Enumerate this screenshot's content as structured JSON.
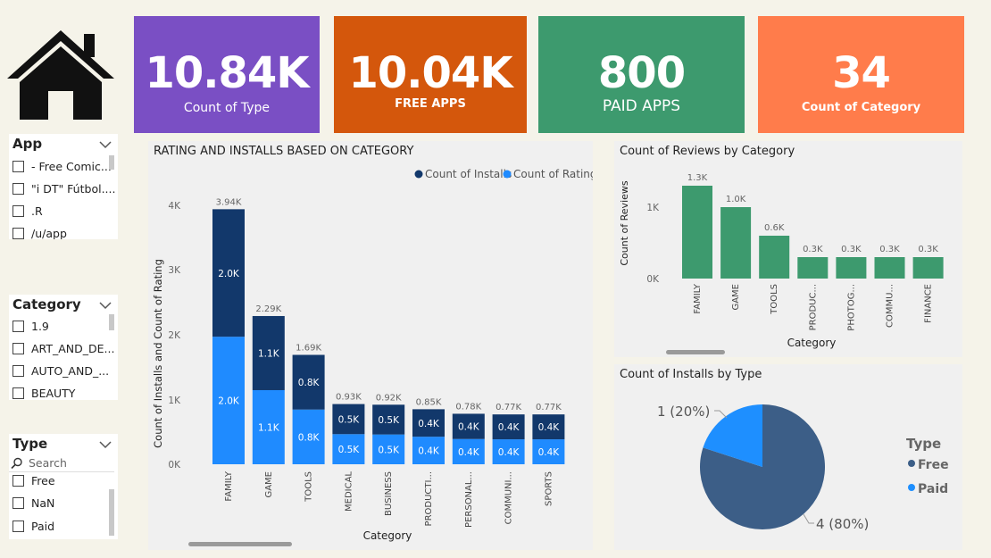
{
  "kpis": [
    {
      "value": "10.84K",
      "label": "Count of Type",
      "color": "#7a4fc4"
    },
    {
      "value": "10.04K",
      "label": "FREE APPS",
      "color": "#d4570c"
    },
    {
      "value": "800",
      "label": "PAID APPS",
      "color": "#3d9a6e"
    },
    {
      "value": "34",
      "label": "Count of Category",
      "color": "#ff7c4b"
    }
  ],
  "home_icon": "home-icon",
  "slicers": {
    "app": {
      "title": "App",
      "items": [
        "- Free Comic...",
        "\"i DT\" Fútbol....",
        ".R",
        "/u/app"
      ]
    },
    "category": {
      "title": "Category",
      "items": [
        "1.9",
        "ART_AND_DE...",
        "AUTO_AND_...",
        "BEAUTY"
      ]
    },
    "type": {
      "title": "Type",
      "search_placeholder": "Search",
      "items": [
        "Free",
        "NaN",
        "Paid"
      ]
    }
  },
  "chart_main": {
    "title": "RATING AND INSTALLS BASED ON CATEGORY",
    "legend": [
      {
        "name": "Count of Installs",
        "color": "#12386b"
      },
      {
        "name": "Count of Rating",
        "color": "#1f8bff"
      }
    ],
    "ylabel": "Count of Installs and Count of Rating",
    "xlabel": "Category",
    "yticks": [
      "0K",
      "1K",
      "2K",
      "3K",
      "4K"
    ]
  },
  "chart_reviews": {
    "title": "Count of Reviews by Category",
    "ylabel": "Count of Reviews",
    "xlabel": "Category",
    "yticks": [
      "0K",
      "1K"
    ],
    "color": "#3d9a6e"
  },
  "chart_pie": {
    "title": "Count of Installs by Type",
    "legend_title": "Type",
    "colors": {
      "Free": "#3c5e87",
      "Paid": "#1e8fff"
    }
  },
  "chart_data": [
    {
      "type": "bar",
      "stacked": true,
      "title": "RATING AND INSTALLS BASED ON CATEGORY",
      "xlabel": "Category",
      "ylabel": "Count of Installs and Count of Rating",
      "categories": [
        "FAMILY",
        "GAME",
        "TOOLS",
        "MEDICAL",
        "BUSINESS",
        "PRODUCTI...",
        "PERSONAL...",
        "COMMUNI...",
        "SPORTS"
      ],
      "series": [
        {
          "name": "Count of Rating",
          "values": [
            1970,
            1145,
            845,
            465,
            460,
            425,
            390,
            385,
            385
          ],
          "labels": [
            "2.0K",
            "1.1K",
            "0.8K",
            "0.5K",
            "0.5K",
            "0.4K",
            "0.4K",
            "0.4K",
            "0.4K"
          ]
        },
        {
          "name": "Count of Installs",
          "values": [
            1970,
            1145,
            845,
            465,
            460,
            425,
            390,
            385,
            385
          ],
          "labels": [
            "2.0K",
            "1.1K",
            "0.8K",
            "0.5K",
            "0.5K",
            "0.4K",
            "0.4K",
            "0.4K",
            "0.4K"
          ]
        }
      ],
      "totals": [
        "3.94K",
        "2.29K",
        "1.69K",
        "0.93K",
        "0.92K",
        "0.85K",
        "0.78K",
        "0.77K",
        "0.77K"
      ],
      "ylim": [
        0,
        4000
      ],
      "legend_position": "top-right",
      "grid": false
    },
    {
      "type": "bar",
      "title": "Count of Reviews by Category",
      "xlabel": "Category",
      "ylabel": "Count of Reviews",
      "categories": [
        "FAMILY",
        "GAME",
        "TOOLS",
        "PRODUC...",
        "PHOTOG...",
        "COMMU...",
        "FINANCE"
      ],
      "values": [
        1300,
        1000,
        600,
        300,
        300,
        300,
        300
      ],
      "labels": [
        "1.3K",
        "1.0K",
        "0.6K",
        "0.3K",
        "0.3K",
        "0.3K",
        "0.3K"
      ],
      "ylim": [
        0,
        1500
      ],
      "grid": false
    },
    {
      "type": "pie",
      "title": "Count of Installs by Type",
      "slices": [
        {
          "name": "Free",
          "value": 4,
          "label": "4 (80%)"
        },
        {
          "name": "Paid",
          "value": 1,
          "label": "1 (20%)"
        }
      ],
      "legend_title": "Type",
      "legend_position": "right"
    }
  ]
}
